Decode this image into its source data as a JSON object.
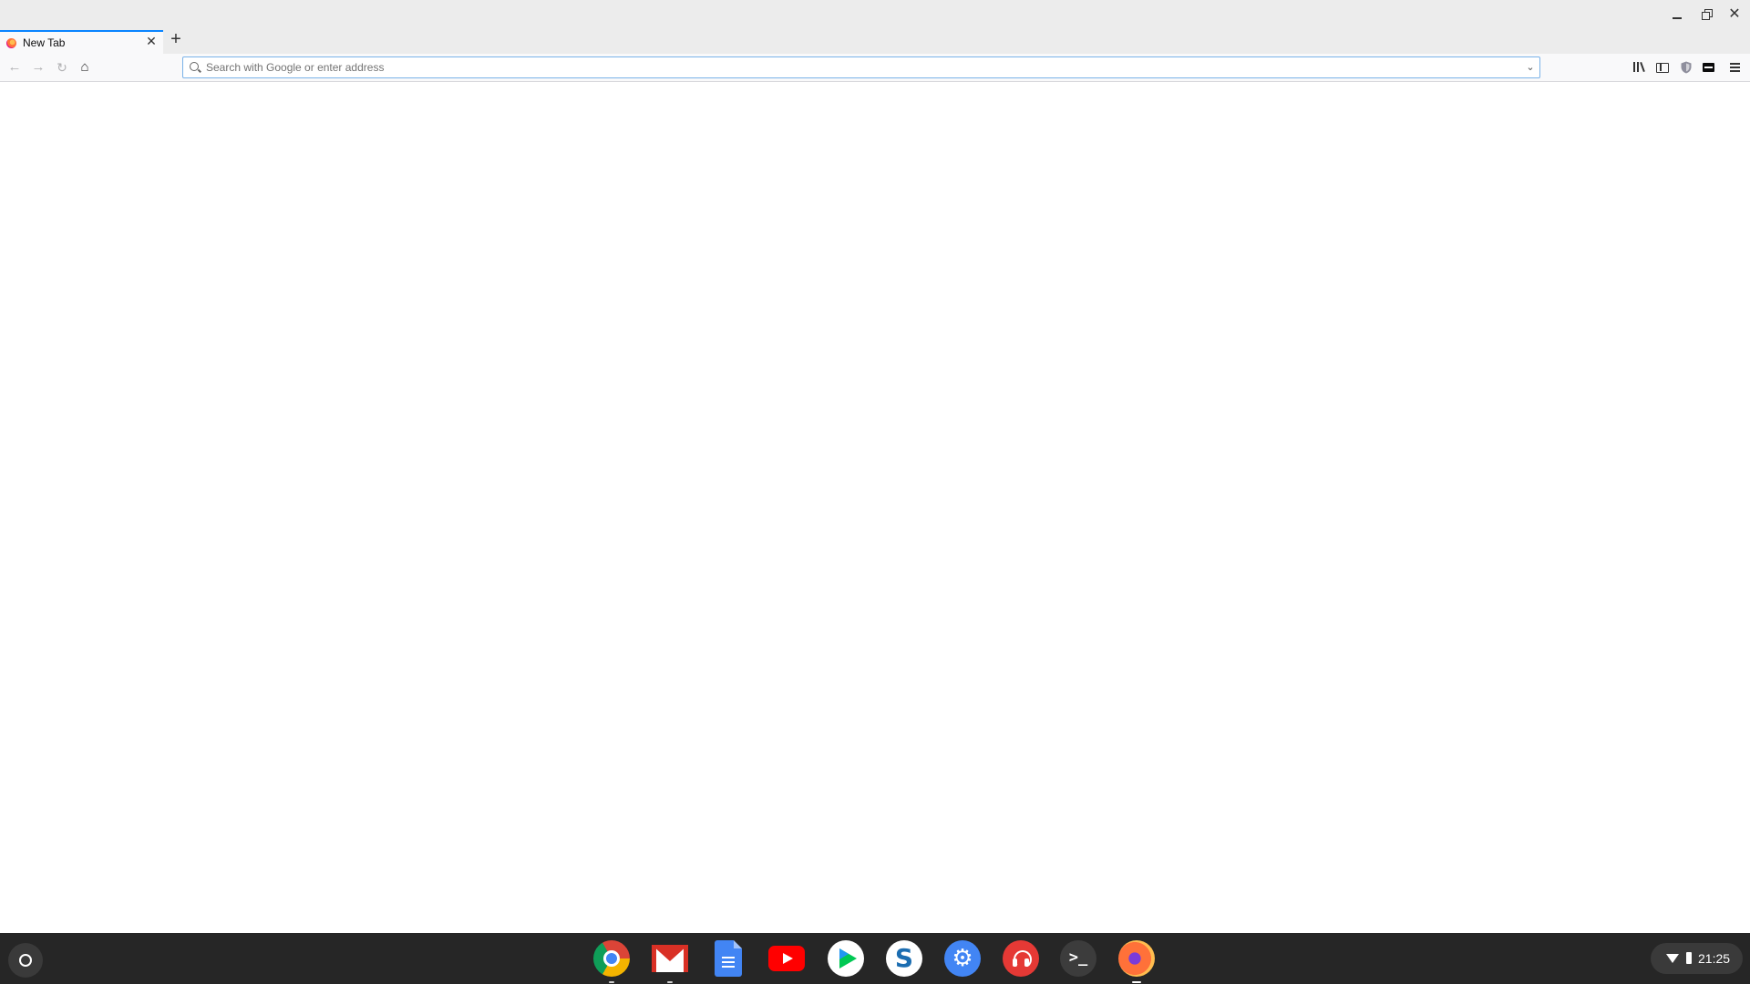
{
  "browser": {
    "tabs": [
      {
        "title": "New Tab",
        "favicon": "firefox-icon",
        "active": true
      }
    ],
    "new_tab_icon": "plus-icon",
    "close_tab_icon": "close-icon",
    "window_controls": [
      "minimize-icon",
      "restore-icon",
      "close-icon"
    ]
  },
  "toolbar": {
    "nav_icons": [
      "back-arrow-icon",
      "forward-arrow-icon",
      "reload-icon",
      "home-icon"
    ],
    "urlbar": {
      "value": "",
      "placeholder": "Search with Google or enter address",
      "icon": "search-icon",
      "dropdown_icon": "chevron-down-icon"
    },
    "right_icons": [
      "library-icon",
      "sidebar-icon",
      "shield-icon",
      "screenshot-icon",
      "hamburger-menu-icon"
    ]
  },
  "shelf": {
    "launcher_icon": "launcher-circle-icon",
    "apps": [
      {
        "name": "chrome-icon",
        "running": true
      },
      {
        "name": "gmail-icon",
        "running": true
      },
      {
        "name": "google-docs-icon",
        "running": false
      },
      {
        "name": "youtube-icon",
        "running": false
      },
      {
        "name": "play-store-icon",
        "running": false
      },
      {
        "name": "simplenote-icon",
        "running": false
      },
      {
        "name": "settings-icon",
        "running": false
      },
      {
        "name": "music-headphones-icon",
        "running": false
      },
      {
        "name": "terminal-icon",
        "running": false
      },
      {
        "name": "firefox-icon",
        "running": true,
        "active": true
      }
    ],
    "status": {
      "wifi_icon": "wifi-icon",
      "battery_icon": "battery-icon",
      "time": "21:25"
    }
  },
  "colors": {
    "accent": "#0a84ff",
    "shelf_background": "#262626",
    "tab_strip": "#ececec"
  }
}
